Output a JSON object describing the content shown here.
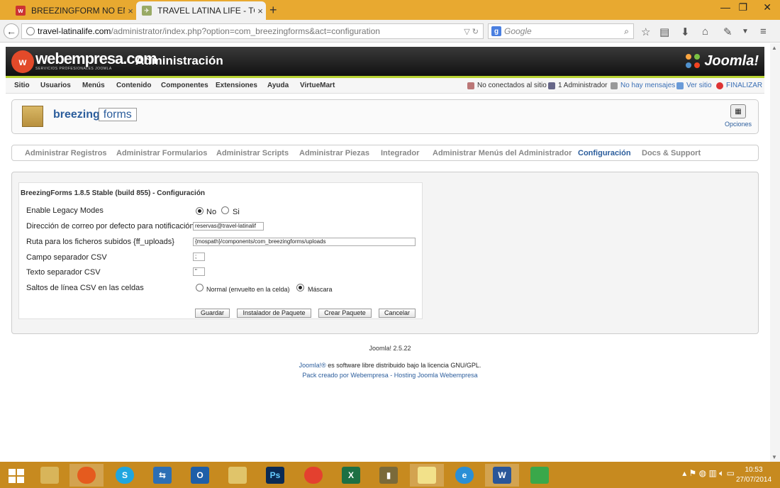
{
  "browser": {
    "tabs": [
      {
        "label": "BREEZINGFORM NO ENVIA...",
        "active": false
      },
      {
        "label": "TRAVEL LATINA LIFE - TO...",
        "active": true
      }
    ],
    "url_host": "travel-latinalife.com",
    "url_path": "/administrator/index.php?option=com_breezingforms&act=configuration",
    "search_placeholder": "Google"
  },
  "joomla": {
    "brand": "webempresa.com",
    "brand_sub": "SERVICIOS PROFESIONALES JOOMLA",
    "admin_title": "Administración",
    "product_logo": "Joomla!",
    "menu": [
      "Sitio",
      "Usuarios",
      "Menús",
      "Contenido",
      "Componentes",
      "Extensiones",
      "Ayuda",
      "VirtueMart"
    ],
    "status": {
      "offline_site": "No conectados al sitio",
      "admins": "1 Administrador",
      "messages": "No hay mensajes",
      "view_site": "Ver sitio",
      "logout": "FINALIZAR"
    }
  },
  "breezing": {
    "logo_a": "breezing",
    "logo_b": "forms",
    "options_label": "Opciones",
    "tabs": [
      "Administrar Registros",
      "Administrar Formularios",
      "Administrar Scripts",
      "Administrar Piezas",
      "Integrador",
      "Administrar Menús del Administrador",
      "Configuración",
      "Docs & Support"
    ],
    "active_tab": "Configuración"
  },
  "config": {
    "title": "BreezingForms 1.8.5 Stable (build 855) - Configuración",
    "legacy_label": "Enable Legacy Modes",
    "legacy_no": "No",
    "legacy_si": "Si",
    "legacy_value": "No",
    "email_label": "Dirección de correo por defecto para notificación",
    "email_value": "reservas@travel-latinalif",
    "uploads_label": "Ruta para los ficheros subidos {ff_uploads}",
    "uploads_value": "{mospath}/components/com_breezingforms/uploads",
    "csv_field_label": "Campo separador CSV",
    "csv_field_value": ";",
    "csv_text_label": "Texto separador CSV",
    "csv_text_value": "\"",
    "csv_newline_label": "Saltos de línea CSV en las celdas",
    "csv_newline_normal": "Normal (envuelto en la celda)",
    "csv_newline_mask": "Máscara",
    "csv_newline_value": "Máscara",
    "buttons": {
      "save": "Guardar",
      "install": "Instalador de Paquete",
      "create": "Crear Paquete",
      "cancel": "Cancelar"
    }
  },
  "footer": {
    "version": "Joomla! 2.5.22",
    "license_link": "Joomla!®",
    "license_text": " es software libre distribuido bajo la licencia GNU/GPL.",
    "credit": "Pack creado por Webempresa - Hosting Joomla Webempresa"
  },
  "taskbar": {
    "time": "10:53",
    "date": "27/07/2014"
  }
}
